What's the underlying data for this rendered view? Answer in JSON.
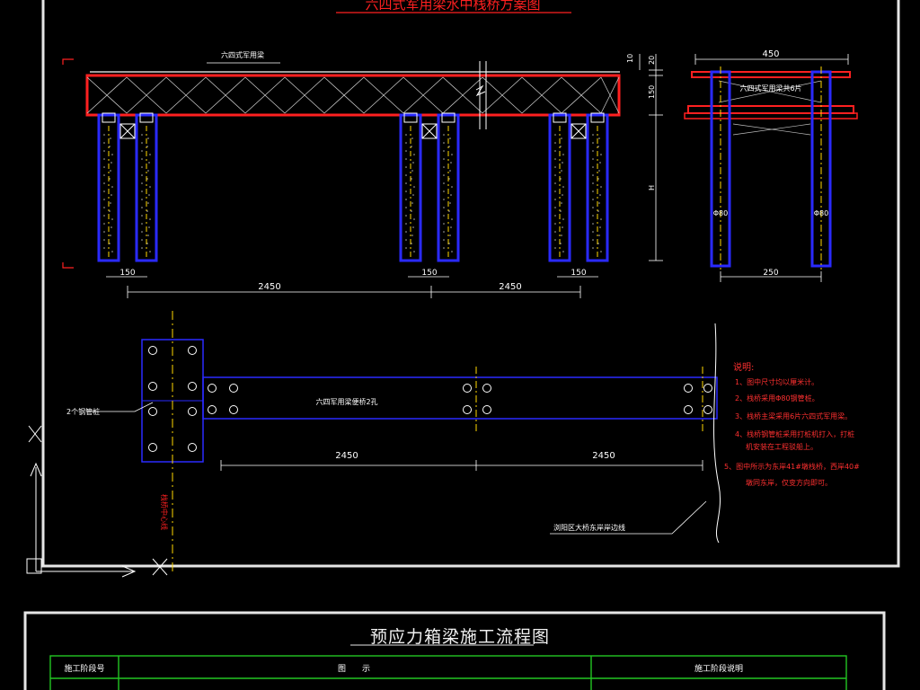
{
  "sheet1": {
    "title": "六四式军用梁水中栈桥方案图",
    "beam_label": "六四式军用梁",
    "dims_top": {
      "d10": "10",
      "d20": "20",
      "d150": "150",
      "dH": "H"
    },
    "dims_bottom": {
      "pile_gap_1": "150",
      "pile_gap_2": "150",
      "pile_gap_3": "150",
      "span_1": "2450",
      "span_2": "2450"
    },
    "section": {
      "width": "450",
      "beam_label": "六四式军用梁共6片",
      "pile_dia_left": "Φ80",
      "pile_dia_right": "Φ80",
      "pile_spacing": "250"
    },
    "plan": {
      "bolt_label": "2个钢管桩",
      "bridge_label": "六四军用梁便桥2孔",
      "span_1": "2450",
      "span_2": "2450",
      "axis_label": "栈桥中心线",
      "bank_label": "浏阳区大桥东岸岸边线"
    },
    "notes": {
      "heading": "说明:",
      "items": [
        "1、图中尺寸均以厘米计。",
        "2、栈桥采用Φ80钢管桩。",
        "3、栈桥主梁采用6片六四式军用梁。",
        "4、栈桥钢管桩采用打桩机打入，打桩",
        "机安装在工程驳船上。",
        "5、图中所示为东岸41#墩栈桥，西岸40#",
        "墩同东岸，仅变方向即可。"
      ]
    },
    "colors": {
      "beam_outline": "#ff2020",
      "pile_outline": "#2a2aff",
      "dim_line": "#ffffff",
      "axis": "#ffd700",
      "notes": "#ff3030"
    }
  },
  "sheet2": {
    "title": "预应力箱梁施工流程图",
    "table_headers": [
      "施工阶段号",
      "图　　示",
      "施工阶段说明"
    ],
    "colors": {
      "grid": "#22c622"
    }
  }
}
